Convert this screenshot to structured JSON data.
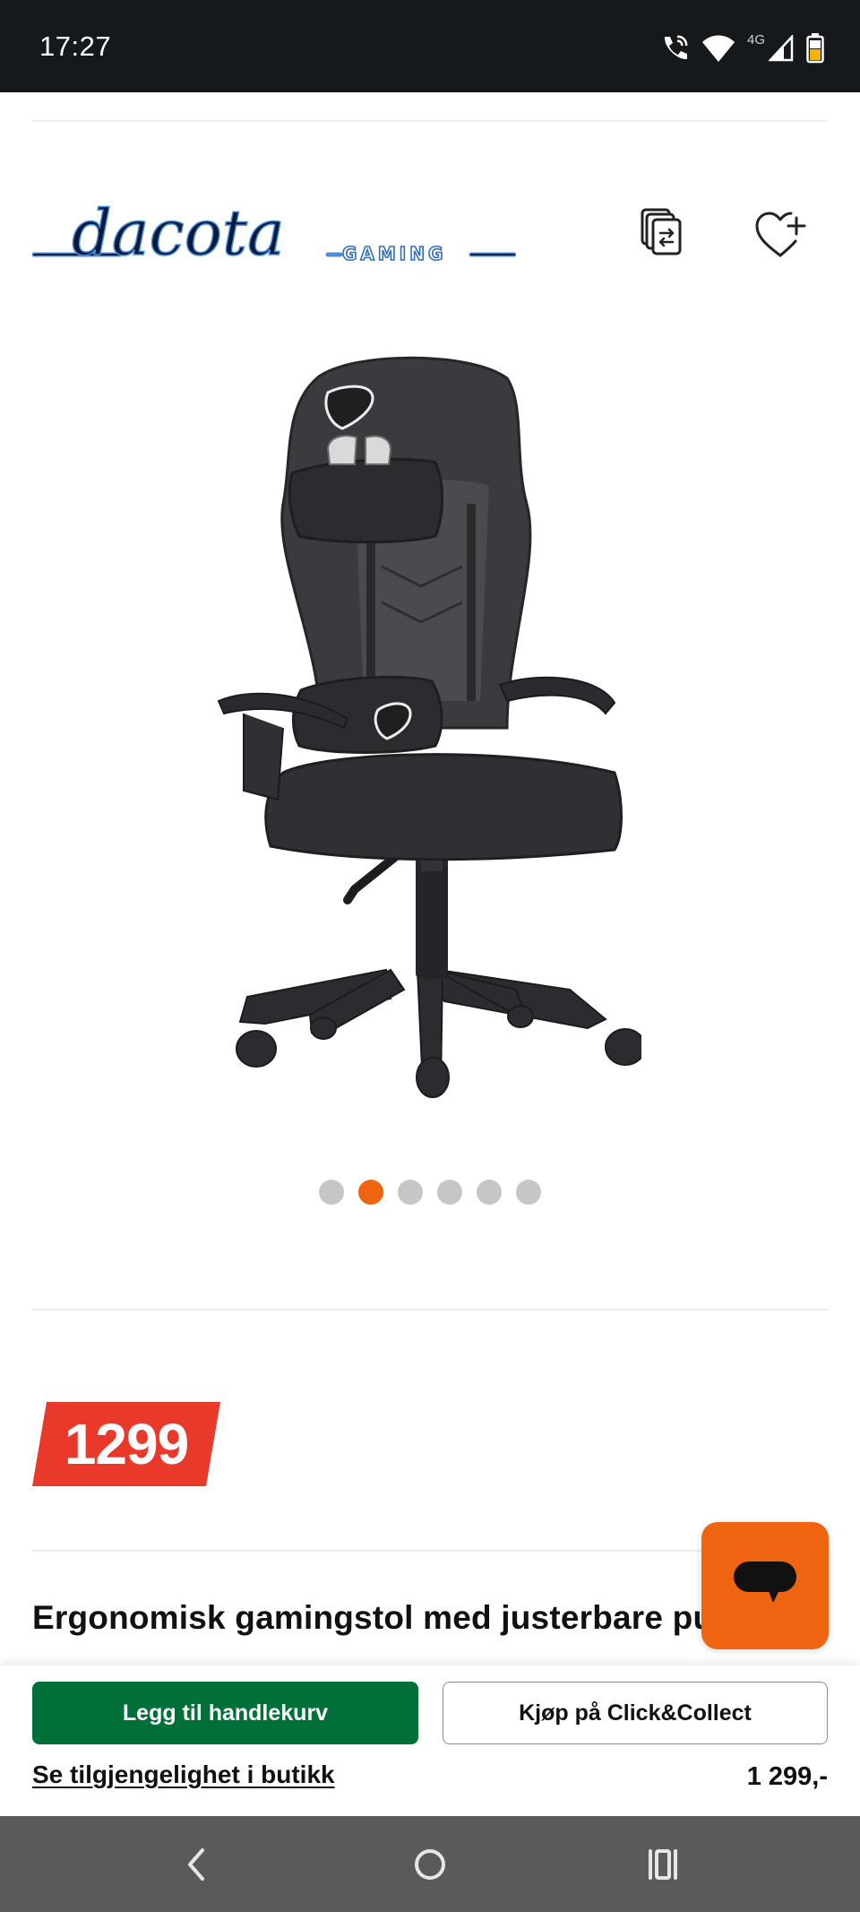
{
  "status_bar": {
    "time": "17:27",
    "network": "4G",
    "icons": [
      "wifi-calling-icon",
      "wifi-icon",
      "signal-icon",
      "battery-icon"
    ]
  },
  "header": {
    "brand": {
      "name": "dacota",
      "sub": "GAMING"
    },
    "compare_icon": "compare-icon",
    "wishlist_icon": "heart-plus-icon"
  },
  "gallery": {
    "image": "gaming-chair-image",
    "image_count": 6,
    "active_index": 1
  },
  "price": {
    "value": "1299",
    "tag_color": "#e8392a"
  },
  "product": {
    "title": "Ergonomisk gamingstol med justerbare puter"
  },
  "chat": {
    "icon": "chat-bubble-icon",
    "color": "#ef6410"
  },
  "actions": {
    "add_to_cart": "Legg til handlekurv",
    "click_collect": "Kjøp på Click&Collect",
    "availability": "Se tilgjengelighet i butikk",
    "price": "1 299,-",
    "primary_color": "#006f38"
  },
  "nav": {
    "back_icon": "back-icon",
    "home_icon": "home-icon",
    "recent_icon": "recent-apps-icon"
  }
}
